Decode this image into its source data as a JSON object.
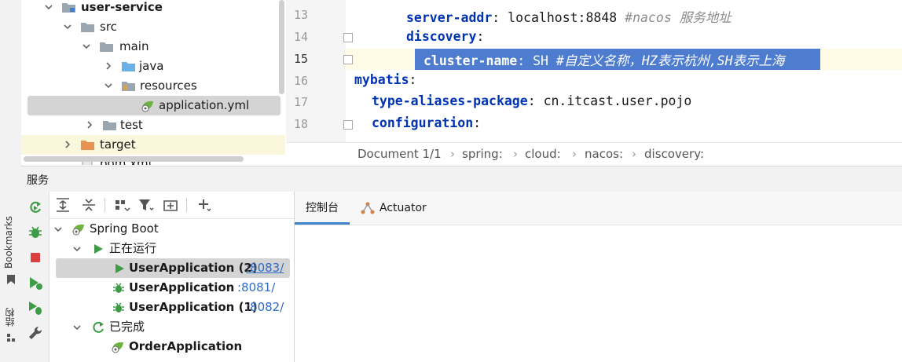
{
  "left_strip": {
    "bookmarks_label": "Bookmarks",
    "structure_label": "结构"
  },
  "project_tree": {
    "items": [
      {
        "label": "user-service",
        "bold": true
      },
      {
        "label": "src"
      },
      {
        "label": "main"
      },
      {
        "label": "java"
      },
      {
        "label": "resources"
      },
      {
        "label": "application.yml",
        "selected": true
      },
      {
        "label": "test"
      },
      {
        "label": "target"
      },
      {
        "label": "pom.xml"
      }
    ]
  },
  "editor": {
    "lines": [
      {
        "number": "13",
        "key": "server-addr",
        "sep": ": ",
        "value": "localhost:8848",
        "comment": " #nacos 服务地址"
      },
      {
        "number": "14",
        "key": "discovery",
        "sep": ":",
        "value": "",
        "comment": ""
      },
      {
        "number": "15",
        "key": "cluster-name",
        "sep": ": ",
        "value": "SH",
        "comment": " #自定义名称，HZ表示杭州,SH表示上海"
      },
      {
        "number": "16",
        "key": "mybatis",
        "sep": ":",
        "value": "",
        "comment": ""
      },
      {
        "number": "17",
        "key": "type-aliases-package",
        "sep": ": ",
        "value": "cn.itcast.user.pojo",
        "comment": ""
      },
      {
        "number": "18",
        "key": "configuration",
        "sep": ":",
        "value": "",
        "comment": ""
      }
    ]
  },
  "breadcrumb": {
    "document": "Document 1/1",
    "items": [
      "spring:",
      "cloud:",
      "nacos:",
      "discovery:"
    ]
  },
  "services": {
    "title": "服务",
    "tree": {
      "root": "Spring Boot",
      "running_group": "正在运行",
      "apps_running": [
        {
          "name": "UserApplication (2)",
          "port": ":8083/",
          "selected": true
        },
        {
          "name": "UserApplication",
          "port": ":8081/"
        },
        {
          "name": "UserApplication (1)",
          "port": ":8082/"
        }
      ],
      "finished_group": "已完成",
      "apps_finished": [
        {
          "name": "OrderApplication"
        }
      ]
    }
  },
  "console": {
    "tabs": [
      {
        "label": "控制台",
        "active": true
      },
      {
        "label": "Actuator"
      }
    ]
  },
  "colors": {
    "selection": "#2f65ca",
    "keyword": "#0033b3",
    "port_link": "#2e6bc4",
    "spring_green": "#6db33f",
    "run_green": "#3f9c46",
    "stop_red": "#d93f3f"
  }
}
